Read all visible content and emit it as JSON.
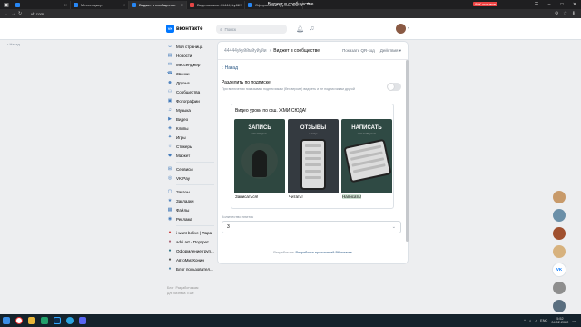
{
  "browser": {
    "tabs": [
      {
        "label": "",
        "active": false
      },
      {
        "label": "Мессенджер",
        "active": false
      },
      {
        "label": "Виджет в сообществе",
        "active": true
      },
      {
        "label": "Видеозаписи 44444ykyйй",
        "active": false
      },
      {
        "label": "Оформление группы. Msi...",
        "active": false
      }
    ],
    "page_title": "Виджет в сообществе",
    "reviews_label": "80К отзывов",
    "url": "vk.com"
  },
  "header": {
    "logo_text": "вконтакте",
    "search_placeholder": "Поиск"
  },
  "back_far": "Назад",
  "menu": {
    "group1": [
      {
        "label": "Моя страница",
        "icon": "user-icon"
      },
      {
        "label": "Новости",
        "icon": "news-icon"
      },
      {
        "label": "Мессенджер",
        "icon": "message-icon"
      },
      {
        "label": "Звонки",
        "icon": "phone-icon"
      },
      {
        "label": "Друзья",
        "icon": "friends-icon"
      },
      {
        "label": "Сообщества",
        "icon": "groups-icon"
      },
      {
        "label": "Фотографии",
        "icon": "photo-icon"
      },
      {
        "label": "Музыка",
        "icon": "music-icon"
      },
      {
        "label": "Видео",
        "icon": "video-icon"
      },
      {
        "label": "Клипы",
        "icon": "clips-icon"
      },
      {
        "label": "Игры",
        "icon": "games-icon"
      },
      {
        "label": "Стикеры",
        "icon": "stickers-icon"
      },
      {
        "label": "Маркет",
        "icon": "market-icon"
      }
    ],
    "group2": [
      {
        "label": "Сервисы",
        "icon": "services-icon"
      },
      {
        "label": "VK Pay",
        "icon": "vkpay-icon"
      }
    ],
    "group3": [
      {
        "label": "Заказы",
        "icon": "orders-icon"
      },
      {
        "label": "Закладки",
        "icon": "bookmark-icon"
      },
      {
        "label": "Файлы",
        "icon": "files-icon"
      },
      {
        "label": "Реклама",
        "icon": "ads-icon"
      }
    ],
    "group4": [
      {
        "label": "i want belive | Пара",
        "icon": "community-icon"
      },
      {
        "label": "advi.art - Портрет...",
        "icon": "community-icon"
      },
      {
        "label": "Оформление груп...",
        "icon": "community-icon"
      },
      {
        "label": "AвтоМихКонин",
        "icon": "community-icon"
      },
      {
        "label": "Блог пользовател...",
        "icon": "community-icon"
      }
    ],
    "footer": [
      "Блог",
      "Разработчикам",
      "Для бизнеса",
      "Ещё"
    ]
  },
  "card": {
    "crumb_group": "44444уkуйймйуйуйи",
    "crumb_current": "Виджет в сообществе",
    "qr_label": "Показать QR-код",
    "actions_label": "Действия",
    "back_label": "Назад",
    "option_title": "Разделить по подписке",
    "option_desc": "При включении показываю подписчикам (без версии) виджеть и не подписчикам другой",
    "toggle_on": false,
    "preview_title": "Видео уроки по фш. ЖМИ СЮДА!",
    "tiles": [
      {
        "big": "ЗАПИСЬ",
        "small": "как смотреть",
        "caption": "Записаться!"
      },
      {
        "big": "ОТЗЫВЫ",
        "small": "и чаще",
        "caption": "Читать!"
      },
      {
        "big": "НАПИСАТЬ",
        "small": "нам сообщение",
        "caption": "Написать!"
      }
    ],
    "count_label": "Количество плиток",
    "count_value": "3",
    "developer_prefix": "Разработчик:",
    "developer_link": "Разработка приложений ВКонтакте"
  },
  "right_widgets": [
    "VK"
  ],
  "taskbar": {
    "time": "5:52",
    "date": "04.02.2022",
    "lang": "ENG"
  },
  "colors": {
    "vk_blue": "#0077ff",
    "link": "#2a5885",
    "bg": "#edeef0"
  }
}
